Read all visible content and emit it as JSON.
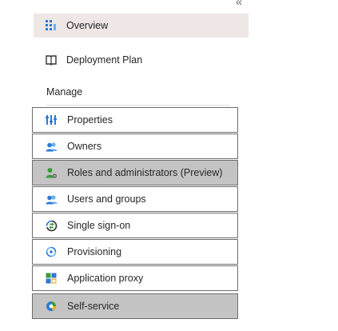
{
  "collapse_glyph": "«",
  "top_items": [
    {
      "label": "Overview",
      "icon": "overview-grid-icon",
      "selected": true
    },
    {
      "label": "Deployment Plan",
      "icon": "book-icon",
      "selected": false
    }
  ],
  "manage": {
    "heading": "Manage",
    "items": [
      {
        "label": "Properties",
        "icon": "properties-sliders-icon",
        "highlighted": false
      },
      {
        "label": "Owners",
        "icon": "owners-people-icon",
        "highlighted": false
      },
      {
        "label": "Roles and administrators (Preview)",
        "icon": "roles-admin-icon",
        "highlighted": true
      },
      {
        "label": "Users and groups",
        "icon": "users-groups-icon",
        "highlighted": false
      },
      {
        "label": "Single sign-on",
        "icon": "single-sign-on-icon",
        "highlighted": false
      },
      {
        "label": "Provisioning",
        "icon": "provisioning-icon",
        "highlighted": false
      },
      {
        "label": "Application proxy",
        "icon": "application-proxy-icon",
        "highlighted": false
      },
      {
        "label": "Self-service",
        "icon": "self-service-icon",
        "highlighted": true
      }
    ]
  },
  "colors": {
    "selected_bg": "#efe6e6",
    "highlight_bg": "#c4c4c4",
    "border": "#6e6e6e",
    "accent_blue": "#2b79d6",
    "accent_green": "#3a9d3a"
  }
}
